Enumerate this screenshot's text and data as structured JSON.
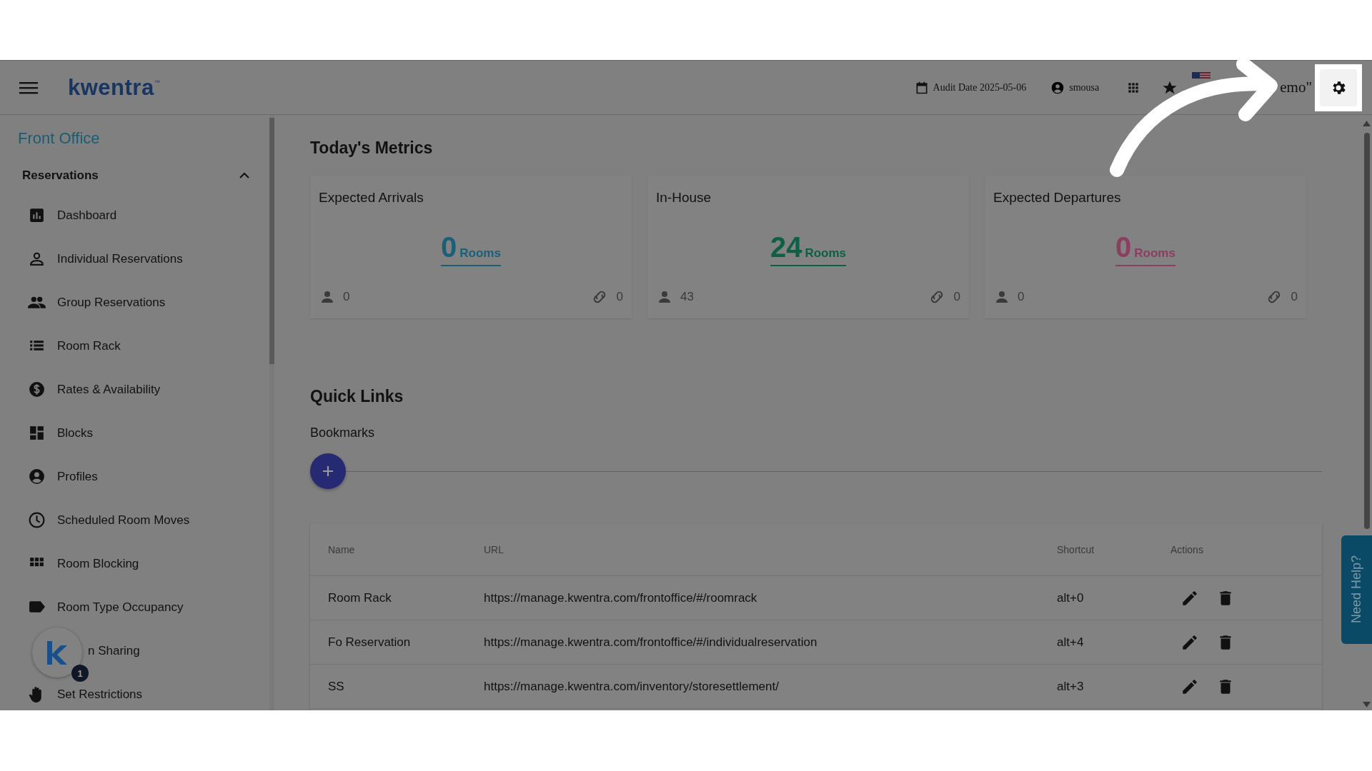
{
  "header": {
    "logo": {
      "name": "kwentra",
      "trademark": "™"
    },
    "audit_date": "Audit Date 2025-05-06",
    "user": "smousa",
    "title_fragment": "emo\""
  },
  "sidebar": {
    "section": "Front Office",
    "group": {
      "label": "Reservations",
      "expanded": true,
      "items": [
        {
          "label": "Dashboard",
          "kind": "plain"
        },
        {
          "label": "Individual Reservations",
          "kind": "plain"
        },
        {
          "label": "Group Reservations",
          "kind": "plain"
        },
        {
          "label": "Room Rack",
          "kind": "plain"
        },
        {
          "label": "Rates & Availability",
          "kind": "plain"
        },
        {
          "label": "Blocks",
          "kind": "plain"
        },
        {
          "label": "Profiles",
          "kind": "plain"
        },
        {
          "label": "Scheduled Room Moves",
          "kind": "plain"
        },
        {
          "label": "Room Blocking",
          "kind": "plain"
        },
        {
          "label": "Room Type Occupancy",
          "kind": "plain"
        },
        {
          "label": "n Sharing",
          "kind": "covered"
        },
        {
          "label": "Set Restrictions",
          "kind": "plain"
        }
      ]
    }
  },
  "chat_badge": {
    "count": "1"
  },
  "metrics": {
    "title": "Today's Metrics",
    "cards": [
      {
        "title": "Expected Arrivals",
        "value": "0",
        "unit": "Rooms",
        "color": "#1b5f78",
        "guests": "0",
        "links": "0"
      },
      {
        "title": "In-House",
        "value": "24",
        "unit": "Rooms",
        "color": "#0d6046",
        "guests": "43",
        "links": "0"
      },
      {
        "title": "Expected Departures",
        "value": "0",
        "unit": "Rooms",
        "color": "#8c3e60",
        "guests": "0",
        "links": "0"
      }
    ]
  },
  "quick_links": {
    "title": "Quick Links",
    "subtitle": "Bookmarks",
    "table": {
      "columns": [
        "Name",
        "URL",
        "Shortcut",
        "Actions"
      ],
      "rows": [
        {
          "name": "Room Rack",
          "url": "https://manage.kwentra.com/frontoffice/#/roomrack",
          "shortcut": "alt+0"
        },
        {
          "name": "Fo Reservation",
          "url": "https://manage.kwentra.com/frontoffice/#/individualreservation",
          "shortcut": "alt+4"
        },
        {
          "name": "SS",
          "url": "https://manage.kwentra.com/inventory/storesettlement/",
          "shortcut": "alt+3"
        }
      ]
    }
  },
  "help_tab": "Need Help?"
}
